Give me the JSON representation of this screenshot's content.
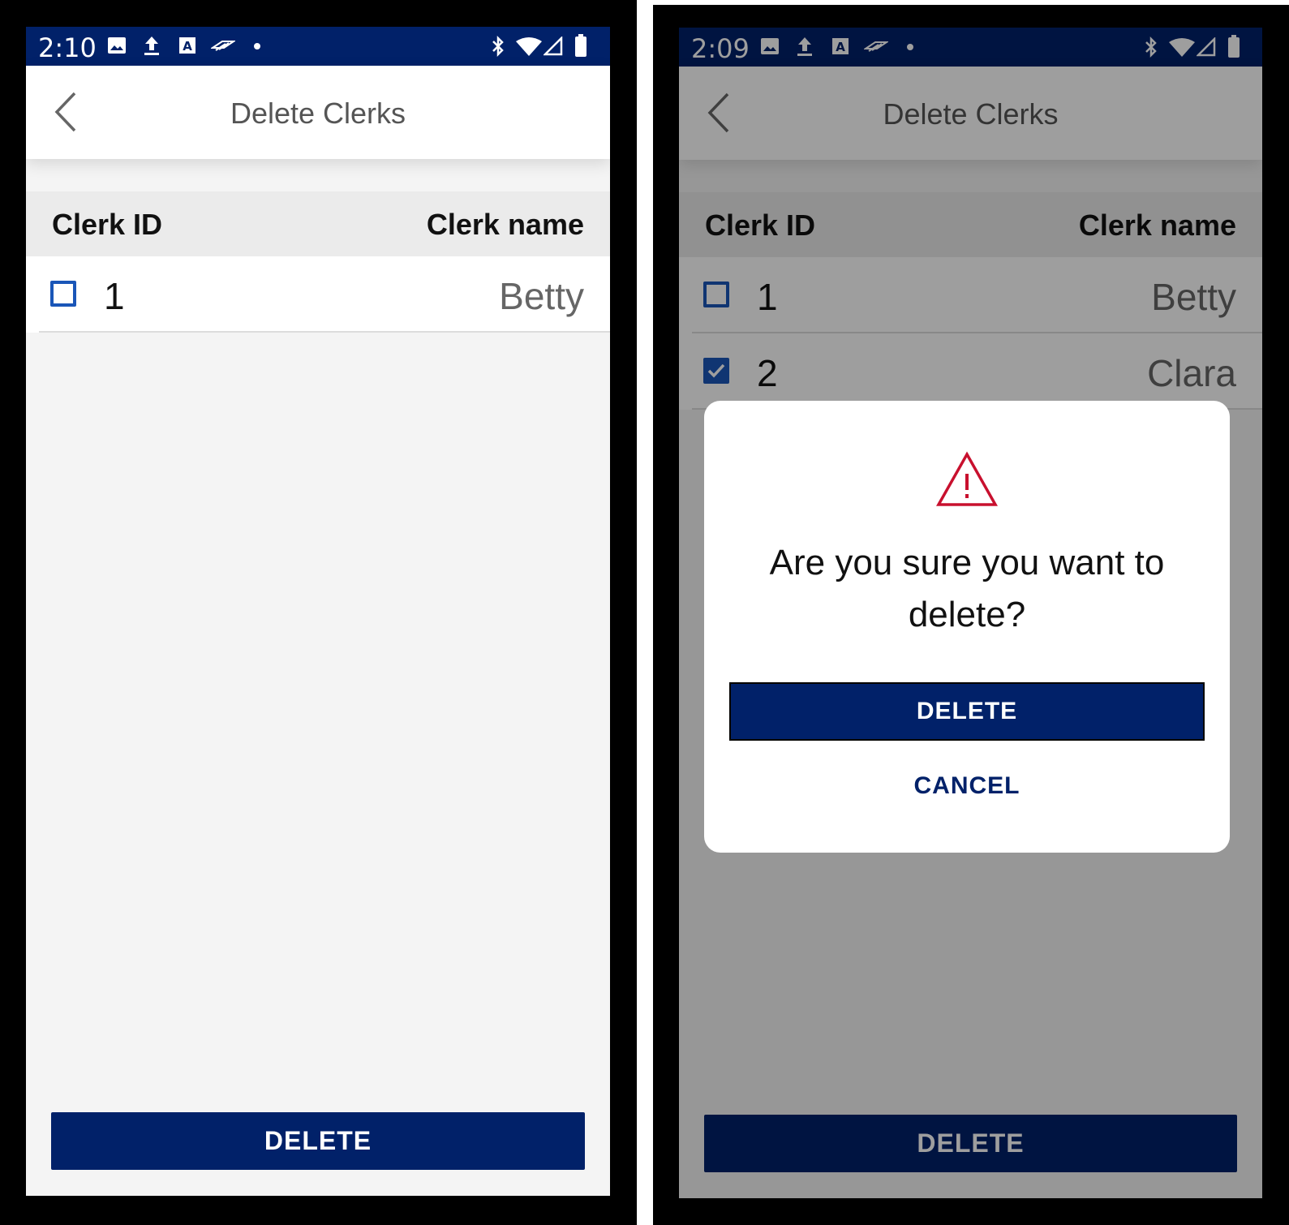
{
  "colors": {
    "brand": "#012169",
    "checkbox": "#1a56b8",
    "warning": "#c8102e"
  },
  "left": {
    "status_time": "2:10",
    "title": "Delete Clerks",
    "header": {
      "id": "Clerk ID",
      "name": "Clerk name"
    },
    "rows": [
      {
        "id": "1",
        "name": "Betty",
        "checked": false
      }
    ],
    "delete_label": "DELETE"
  },
  "right": {
    "status_time": "2:09",
    "title": "Delete Clerks",
    "header": {
      "id": "Clerk ID",
      "name": "Clerk name"
    },
    "rows": [
      {
        "id": "1",
        "name": "Betty",
        "checked": false
      },
      {
        "id": "2",
        "name": "Clara",
        "checked": true
      }
    ],
    "delete_label": "DELETE",
    "dialog": {
      "icon": "warning-icon",
      "message": "Are you sure you want to delete?",
      "confirm_label": "DELETE",
      "cancel_label": "CANCEL"
    }
  },
  "status_icons": [
    "image-icon",
    "upload-icon",
    "a-icon",
    "bank-icon",
    "dot-icon",
    "bluetooth-icon",
    "wifi-icon",
    "signal-icon",
    "battery-icon"
  ]
}
